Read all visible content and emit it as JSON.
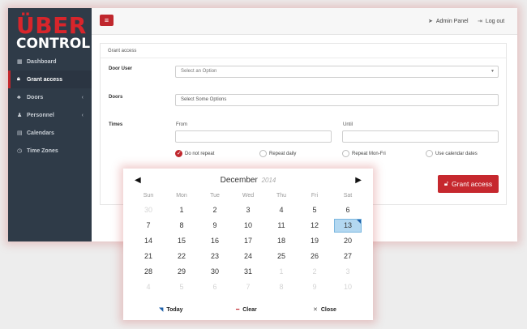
{
  "app": {
    "logo_line1": "ÜBER",
    "logo_line2": "CONTROL",
    "menu_icon": "hamburger-icon"
  },
  "sidebar": {
    "items": [
      {
        "label": "Dashboard",
        "icon": "grid-icon"
      },
      {
        "label": "Grant access",
        "icon": "lock-icon",
        "active": true
      },
      {
        "label": "Doors",
        "icon": "sitemap-icon",
        "has_children": true
      },
      {
        "label": "Personnel",
        "icon": "users-icon",
        "has_children": true
      },
      {
        "label": "Calendars",
        "icon": "calendar-icon"
      },
      {
        "label": "Time Zones",
        "icon": "clock-icon"
      }
    ]
  },
  "topbar": {
    "admin_panel": "Admin Panel",
    "logout": "Log out"
  },
  "form": {
    "panel_title": "Grant access",
    "door_user_label": "Door User",
    "door_user_placeholder": "Select an Option",
    "doors_label": "Doors",
    "doors_placeholder": "Select Some Options",
    "times_label": "Times",
    "from_label": "From",
    "until_label": "Until",
    "radio_options": [
      {
        "label": "Do not repeat",
        "checked": true
      },
      {
        "label": "Repeat daily",
        "checked": false
      },
      {
        "label": "Repeat Mon-Fri",
        "checked": false
      },
      {
        "label": "Use calendar dates",
        "checked": false
      }
    ],
    "submit_label": "Grant access"
  },
  "calendar": {
    "month": "December",
    "year": "2014",
    "weekdays": [
      "Sun",
      "Mon",
      "Tue",
      "Wed",
      "Thu",
      "Fri",
      "Sat"
    ],
    "weeks": [
      [
        {
          "d": "30",
          "m": true
        },
        {
          "d": "1"
        },
        {
          "d": "2"
        },
        {
          "d": "3"
        },
        {
          "d": "4"
        },
        {
          "d": "5"
        },
        {
          "d": "6"
        }
      ],
      [
        {
          "d": "7"
        },
        {
          "d": "8"
        },
        {
          "d": "9"
        },
        {
          "d": "10"
        },
        {
          "d": "11"
        },
        {
          "d": "12"
        },
        {
          "d": "13",
          "today": true
        }
      ],
      [
        {
          "d": "14"
        },
        {
          "d": "15"
        },
        {
          "d": "16"
        },
        {
          "d": "17"
        },
        {
          "d": "18"
        },
        {
          "d": "19"
        },
        {
          "d": "20"
        }
      ],
      [
        {
          "d": "21"
        },
        {
          "d": "22"
        },
        {
          "d": "23"
        },
        {
          "d": "24"
        },
        {
          "d": "25"
        },
        {
          "d": "26"
        },
        {
          "d": "27"
        }
      ],
      [
        {
          "d": "28"
        },
        {
          "d": "29"
        },
        {
          "d": "30"
        },
        {
          "d": "31"
        },
        {
          "d": "1",
          "m": true
        },
        {
          "d": "2",
          "m": true
        },
        {
          "d": "3",
          "m": true
        }
      ],
      [
        {
          "d": "4",
          "m": true
        },
        {
          "d": "5",
          "m": true
        },
        {
          "d": "6",
          "m": true
        },
        {
          "d": "7",
          "m": true
        },
        {
          "d": "8",
          "m": true
        },
        {
          "d": "9",
          "m": true
        },
        {
          "d": "10",
          "m": true
        }
      ]
    ],
    "today_label": "Today",
    "clear_label": "Clear",
    "close_label": "Close",
    "accent_color": "#b3d8f1"
  },
  "colors": {
    "brand_red": "#c0272d",
    "sidebar_bg": "#2f3b48"
  }
}
